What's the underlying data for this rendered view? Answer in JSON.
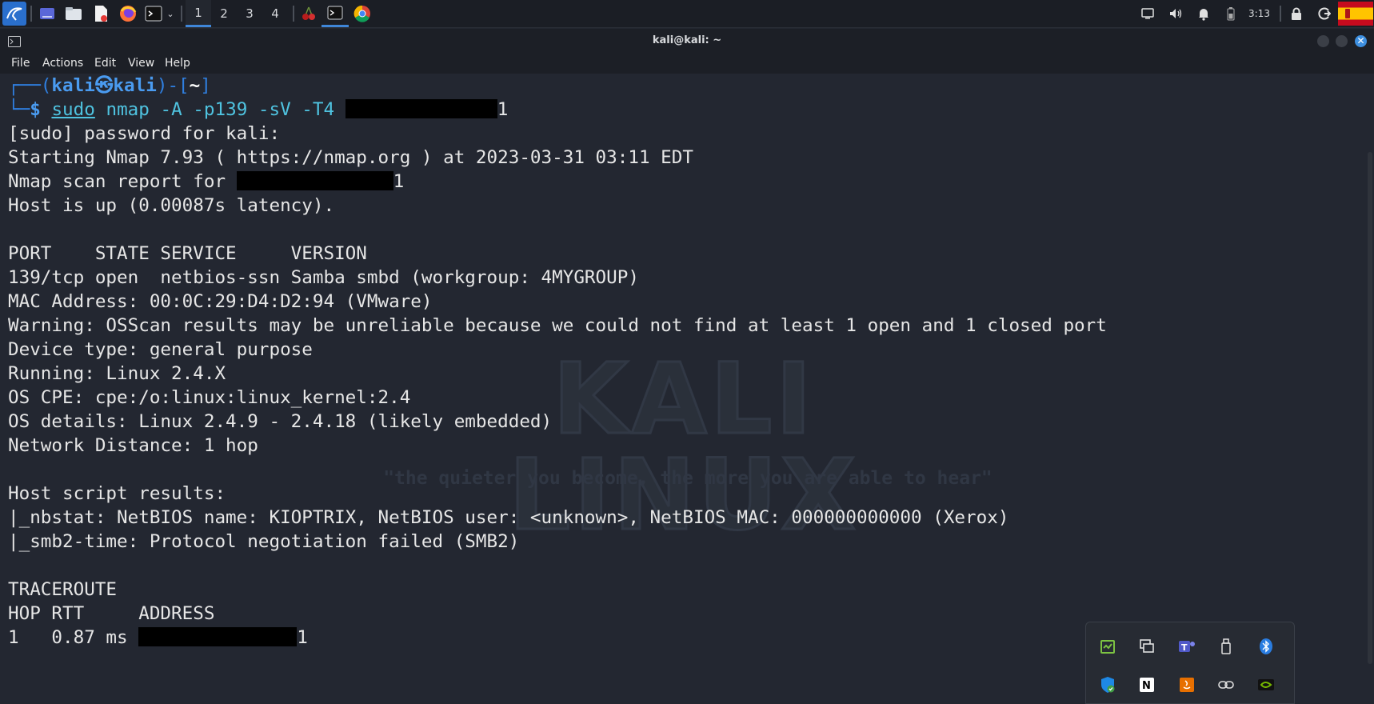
{
  "taskbar": {
    "workspaces": [
      "1",
      "2",
      "3",
      "4"
    ],
    "active_workspace": "1",
    "clock": "3:13",
    "apps": [
      "kali-menu-icon",
      "show-desktop-icon",
      "file-manager-icon",
      "text-editor-icon",
      "firefox-icon",
      "terminal-icon",
      "cherrytree-icon",
      "terminal-icon",
      "chrome-icon"
    ]
  },
  "window": {
    "title": "kali@kali: ~",
    "menu": [
      "File",
      "Actions",
      "Edit",
      "View",
      "Help"
    ]
  },
  "terminal": {
    "prompt_top": "┌──(",
    "prompt_user": "kali㉿kali",
    "prompt_mid": ")-[",
    "prompt_dir": "~",
    "prompt_end": "]",
    "prompt_bottom": "└─",
    "prompt_sign": "$ ",
    "cmd_sudo": "sudo",
    "cmd_rest": " nmap -A -p139 -sV -T4 ",
    "cmd_ip_tail": "1",
    "lines": [
      "[sudo] password for kali:",
      "Starting Nmap 7.93 ( https://nmap.org ) at 2023-03-31 03:11 EDT",
      "Nmap scan report for ",
      "Host is up (0.00087s latency).",
      "",
      "PORT    STATE SERVICE     VERSION",
      "139/tcp open  netbios-ssn Samba smbd (workgroup: 4MYGROUP)",
      "MAC Address: 00:0C:29:D4:D2:94 (VMware)",
      "Warning: OSScan results may be unreliable because we could not find at least 1 open and 1 closed port",
      "Device type: general purpose",
      "Running: Linux 2.4.X",
      "OS CPE: cpe:/o:linux:linux_kernel:2.4",
      "OS details: Linux 2.4.9 - 2.4.18 (likely embedded)",
      "Network Distance: 1 hop",
      "",
      "Host script results:",
      "|_nbstat: NetBIOS name: KIOPTRIX, NetBIOS user: <unknown>, NetBIOS MAC: 000000000000 (Xerox)",
      "|_smb2-time: Protocol negotiation failed (SMB2)",
      "",
      "TRACEROUTE",
      "HOP RTT     ADDRESS",
      "1   0.87 ms "
    ],
    "report_ip_tail": "1",
    "trace_ip_tail": "1"
  },
  "wallpaper": {
    "watermark": "KALI LINUX",
    "tagline": "\"the quieter you become, the more you are able to hear\""
  },
  "tray_popup": {
    "icons": [
      "clipboard-icon",
      "screen-share-icon",
      "teams-icon",
      "usb-drive-icon",
      "bluetooth-icon",
      "security-shield-icon",
      "notion-icon",
      "java-icon",
      "link-icon",
      "nvidia-icon"
    ]
  },
  "colors": {
    "accent": "#3f86d8",
    "prompt": "#2f7fe0",
    "command": "#4fc3e0",
    "terminal_bg": "#232731"
  }
}
